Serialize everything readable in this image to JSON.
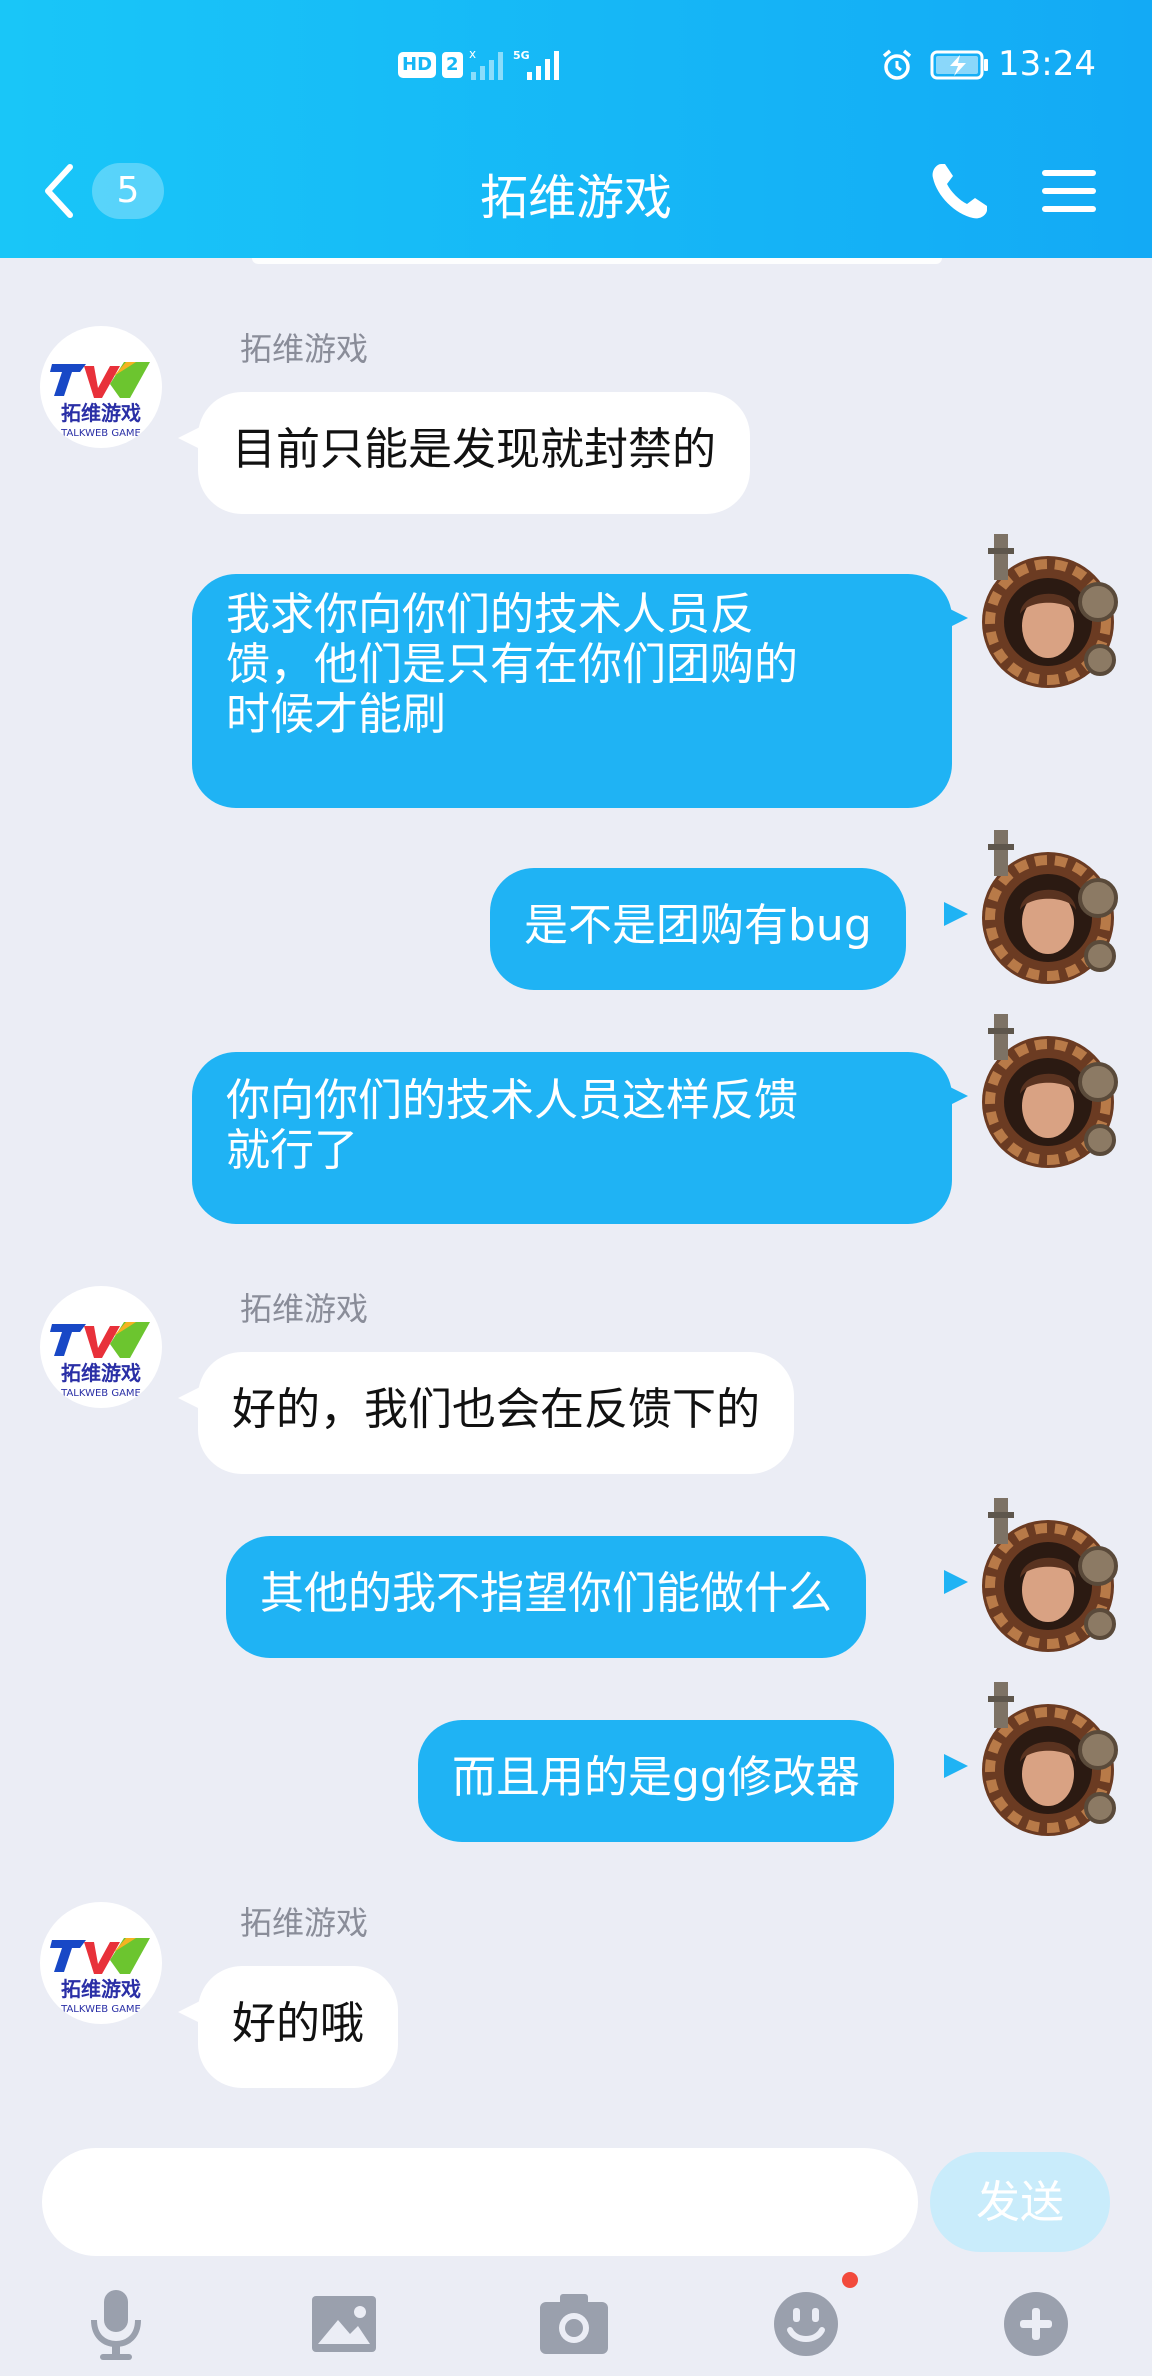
{
  "status_bar": {
    "hd": "HD",
    "sim": "2",
    "time": "13:24"
  },
  "nav": {
    "back_count": "5",
    "title": "拓维游戏"
  },
  "messages": [
    {
      "side": "left",
      "sender": "拓维游戏",
      "text": "目前只能是发现就封禁的"
    },
    {
      "side": "right",
      "text": "我求你向你们的技术人员反\n馈，他们是只有在你们团购的\n时候才能刷"
    },
    {
      "side": "right",
      "text": "是不是团购有bug"
    },
    {
      "side": "right",
      "text": "你向你们的技术人员这样反馈\n就行了"
    },
    {
      "side": "left",
      "sender": "拓维游戏",
      "text": "好的，我们也会在反馈下的"
    },
    {
      "side": "right",
      "text": "其他的我不指望你们能做什么"
    },
    {
      "side": "right",
      "text": "而且用的是gg修改器"
    },
    {
      "side": "left",
      "sender": "拓维游戏",
      "text": "好的哦"
    }
  ],
  "brand_logo": {
    "cn": "拓维游戏",
    "en": "TALKWEB GAME"
  },
  "input": {
    "value": "",
    "placeholder": "",
    "send_label": "发送"
  },
  "toolbar": {
    "icons": [
      "microphone-icon",
      "image-icon",
      "camera-icon",
      "emoji-icon",
      "plus-icon"
    ]
  },
  "colors": {
    "header": "#13aaf5",
    "bubble_right": "#1fb3f4",
    "bubble_left": "#ffffff",
    "background": "#ebedf5",
    "badge": "#f24a3c"
  }
}
